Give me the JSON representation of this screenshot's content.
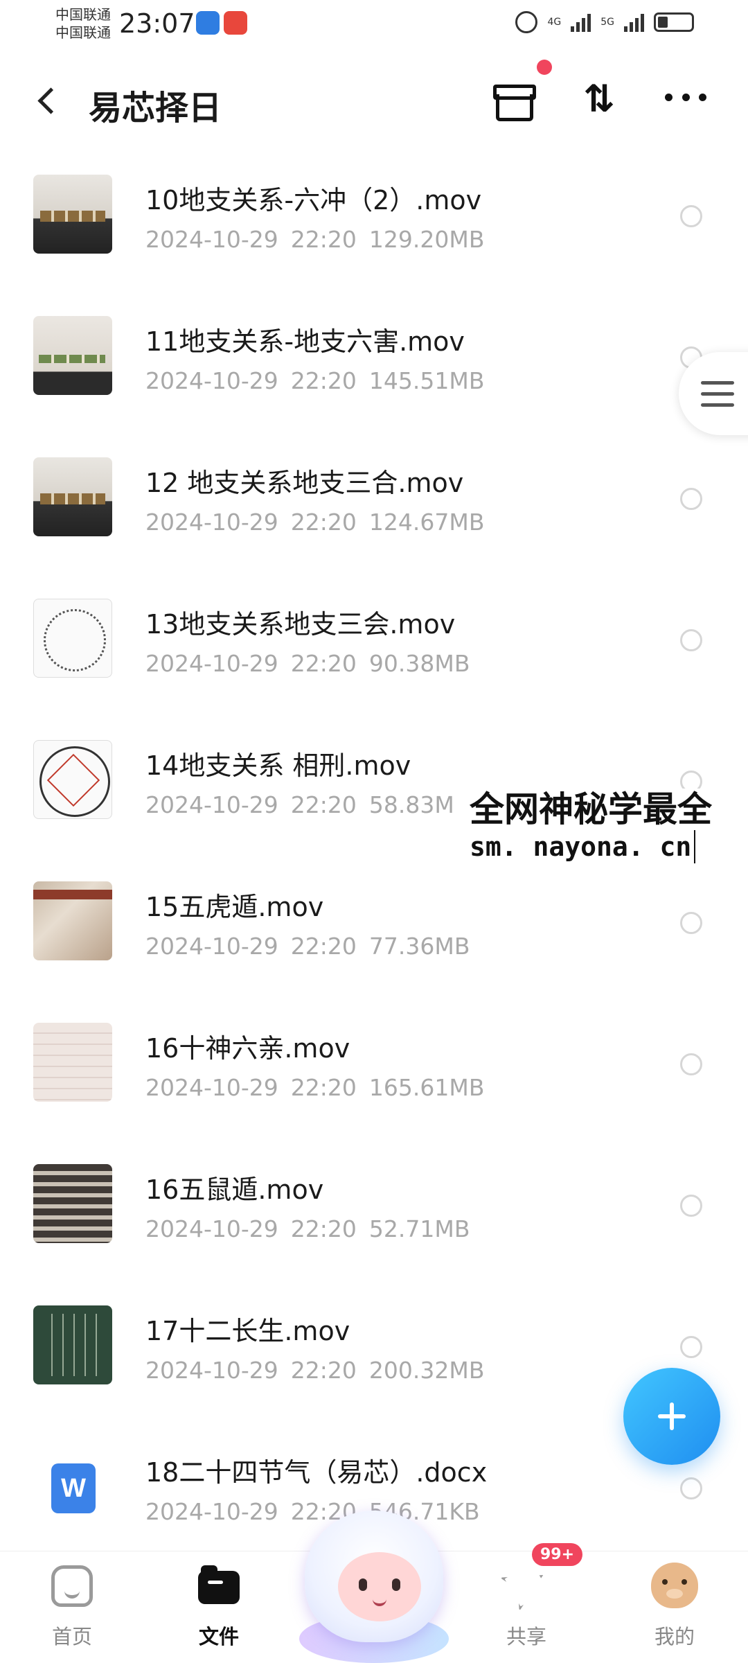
{
  "status_bar": {
    "carrier_1": "中国联通",
    "carrier_2": "中国联通",
    "time": "23:07",
    "net_1": "4G",
    "net_2": "5G"
  },
  "header": {
    "title": "易芯择日",
    "sort_glyph": "⇅"
  },
  "files": [
    {
      "name": "10地支关系-六冲（2）.mov",
      "date": "2024-10-29",
      "time": "22:20",
      "size": "129.20MB",
      "thumb": "paper"
    },
    {
      "name": "11地支关系-地支六害.mov",
      "date": "2024-10-29",
      "time": "22:20",
      "size": "145.51MB",
      "thumb": "paper2"
    },
    {
      "name": "12 地支关系地支三合.mov",
      "date": "2024-10-29",
      "time": "22:20",
      "size": "124.67MB",
      "thumb": "paper"
    },
    {
      "name": "13地支关系地支三会.mov",
      "date": "2024-10-29",
      "time": "22:20",
      "size": "90.38MB",
      "thumb": "circle-chart"
    },
    {
      "name": "14地支关系 相刑.mov",
      "date": "2024-10-29",
      "time": "22:20",
      "size": "58.83M",
      "thumb": "star-chart"
    },
    {
      "name": "15五虎遁.mov",
      "date": "2024-10-29",
      "time": "22:20",
      "size": "77.36MB",
      "thumb": "book"
    },
    {
      "name": "16十神六亲.mov",
      "date": "2024-10-29",
      "time": "22:20",
      "size": "165.61MB",
      "thumb": "notes"
    },
    {
      "name": "16五鼠遁.mov",
      "date": "2024-10-29",
      "time": "22:20",
      "size": "52.71MB",
      "thumb": "table"
    },
    {
      "name": "17十二长生.mov",
      "date": "2024-10-29",
      "time": "22:20",
      "size": "200.32MB",
      "thumb": "board"
    },
    {
      "name": "18二十四节气（易芯）.docx",
      "date": "2024-10-29",
      "time": "22:20",
      "size": "546.71KB",
      "thumb": "word"
    }
  ],
  "word_icon_letter": "W",
  "watermark": {
    "title": "全网神秘学最全",
    "url": "sm. nayona. cn"
  },
  "bottom_nav": {
    "home": "首页",
    "files": "文件",
    "share": "共享",
    "share_badge": "99+",
    "me": "我的"
  },
  "colors": {
    "accent": "#1f8ef0",
    "badge": "#f0455d",
    "meta_text": "#a8a8a8"
  }
}
